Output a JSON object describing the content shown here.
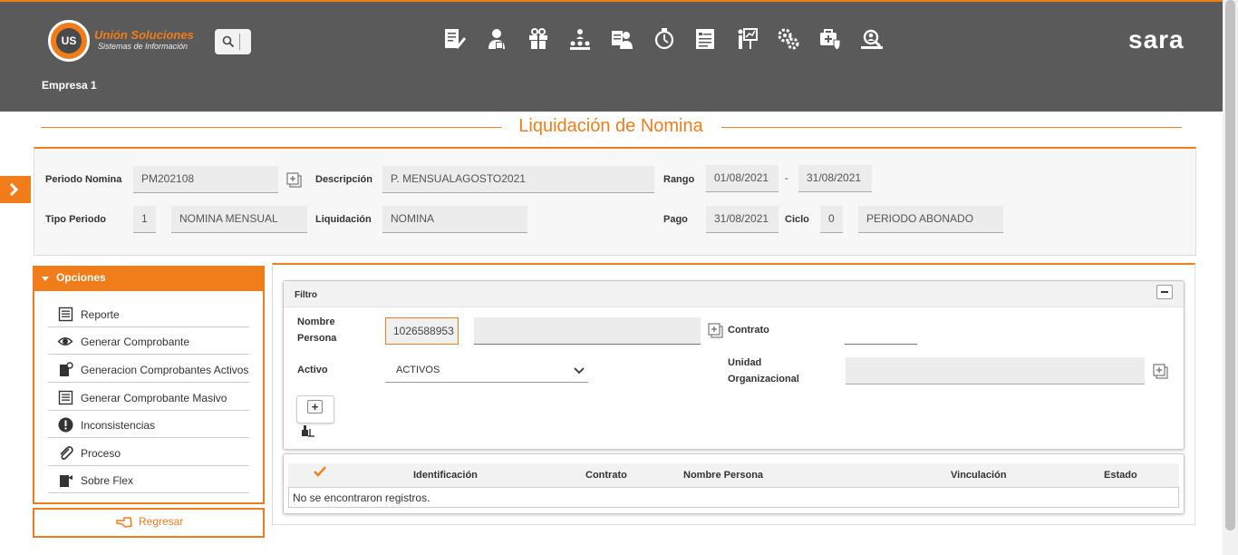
{
  "header": {
    "logo_initials": "US",
    "logo_name": "Unión Soluciones",
    "logo_sub": "Sistemas de Información",
    "brand": "sara",
    "company": "Empresa 1",
    "nav_icons": [
      "document-edit-icon",
      "user-doc-icon",
      "gift-icon",
      "org-chart-icon",
      "employee-card-icon",
      "timer-icon",
      "form-list-icon",
      "presentation-icon",
      "gears-icon",
      "medical-bag-icon",
      "people-search-icon"
    ]
  },
  "page": {
    "title": "Liquidación de Nomina"
  },
  "period": {
    "periodo_label": "Periodo Nomina",
    "periodo_value": "PM202108",
    "descripcion_label": "Descripción",
    "descripcion_value": "P. MENSUALAGOSTO2021",
    "rango_label": "Rango",
    "rango_start": "01/08/2021",
    "rango_sep": "-",
    "rango_end": "31/08/2021",
    "tipo_label": "Tipo Periodo",
    "tipo_code": "1",
    "tipo_value": "NOMINA MENSUAL",
    "liquidacion_label": "Liquidación",
    "liquidacion_value": "NOMINA",
    "pago_label": "Pago",
    "pago_value": "31/08/2021",
    "ciclo_label": "Ciclo",
    "ciclo_code": "0",
    "ciclo_value": "PERIODO ABONADO"
  },
  "options": {
    "title": "Opciones",
    "items": [
      {
        "label": "Reporte"
      },
      {
        "label": "Generar Comprobante"
      },
      {
        "label": "Generacion Comprobantes Activos"
      },
      {
        "label": "Generar Comprobante Masivo"
      },
      {
        "label": "Inconsistencias"
      },
      {
        "label": "Proceso"
      },
      {
        "label": "Sobre Flex"
      }
    ],
    "back_label": "Regresar"
  },
  "filter": {
    "title": "Filtro",
    "nombre_label_1": "Nombre",
    "nombre_label_2": "Persona",
    "nombre_value": "1026588953",
    "contrato_label": "Contrato",
    "activo_label": "Activo",
    "activo_value": "ACTIVOS",
    "unidad_label_1": "Unidad",
    "unidad_label_2": "Organizacional",
    "add_symbol": "+"
  },
  "table": {
    "columns": [
      "Identificación",
      "Contrato",
      "Nombre Persona",
      "Vinculación",
      "Estado"
    ],
    "empty_message": "No se encontraron registros."
  },
  "colors": {
    "accent": "#f07d1a",
    "topbar": "#5a5a5a"
  }
}
